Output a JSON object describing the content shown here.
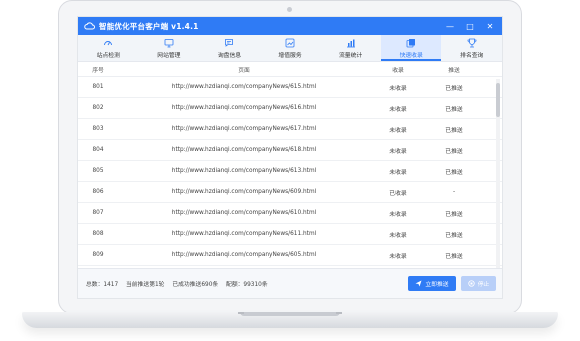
{
  "app": {
    "title": "智能优化平台客户端 v1.4.1",
    "accent": "#2f7bf5",
    "window_controls": [
      "—",
      "□",
      "✕"
    ]
  },
  "toolbar": {
    "items": [
      {
        "label": "站点检测",
        "icon": "gauge-icon"
      },
      {
        "label": "网站管理",
        "icon": "monitor-icon"
      },
      {
        "label": "询盘信息",
        "icon": "chat-icon"
      },
      {
        "label": "增值服务",
        "icon": "edit-chart-icon"
      },
      {
        "label": "流量统计",
        "icon": "bar-chart-icon"
      },
      {
        "label": "快速收录",
        "icon": "copy-icon",
        "active": true
      },
      {
        "label": "排名查询",
        "icon": "trophy-icon"
      }
    ]
  },
  "table": {
    "headers": [
      "序号",
      "页面",
      "收录",
      "推送"
    ],
    "rows": [
      {
        "id": "801",
        "url": "http://www.hzdianqi.com/companyNews/615.html",
        "included": "未收录",
        "pushed": "已推送"
      },
      {
        "id": "802",
        "url": "http://www.hzdianqi.com/companyNews/616.html",
        "included": "未收录",
        "pushed": "已推送"
      },
      {
        "id": "803",
        "url": "http://www.hzdianqi.com/companyNews/617.html",
        "included": "未收录",
        "pushed": "已推送"
      },
      {
        "id": "804",
        "url": "http://www.hzdianqi.com/companyNews/618.html",
        "included": "未收录",
        "pushed": "已推送"
      },
      {
        "id": "805",
        "url": "http://www.hzdianqi.com/companyNews/613.html",
        "included": "未收录",
        "pushed": "已推送"
      },
      {
        "id": "806",
        "url": "http://www.hzdianqi.com/companyNews/609.html",
        "included": "已收录",
        "pushed": "-"
      },
      {
        "id": "807",
        "url": "http://www.hzdianqi.com/companyNews/610.html",
        "included": "未收录",
        "pushed": "已推送"
      },
      {
        "id": "808",
        "url": "http://www.hzdianqi.com/companyNews/611.html",
        "included": "未收录",
        "pushed": "已推送"
      },
      {
        "id": "809",
        "url": "http://www.hzdianqi.com/companyNews/605.html",
        "included": "未收录",
        "pushed": "已推送"
      }
    ]
  },
  "footer": {
    "total": "总数：1417",
    "round": "当前推送第1轮",
    "success": "已成功推送690条",
    "quota": "配额：99310条",
    "push_button": "立即推送",
    "stop_button": "停止"
  }
}
